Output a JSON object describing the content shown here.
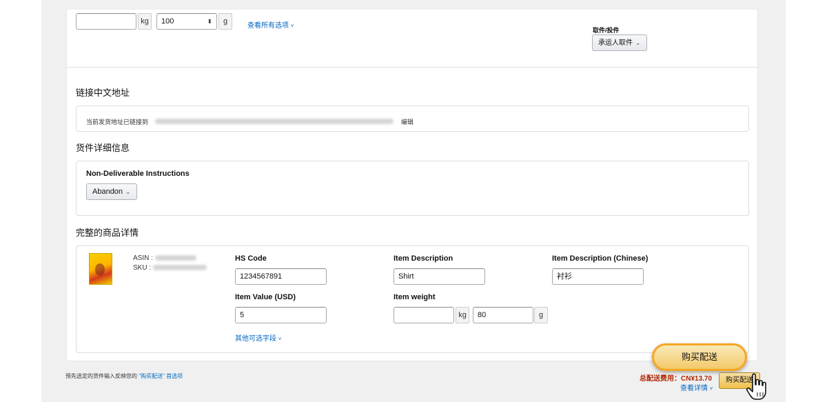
{
  "top": {
    "weight_kg_value": "",
    "weight_kg_unit": "kg",
    "weight_g_value": "100",
    "weight_g_unit": "g",
    "view_all_options_link": "查看所有选项",
    "pickup_label": "取件/投件",
    "pickup_select": "承运人取件"
  },
  "linked_address": {
    "heading": "链接中文地址",
    "text": "当前发货地址已链接到",
    "edit_link": "编辑"
  },
  "shipment_details": {
    "heading": "货件详细信息",
    "non_deliverable_label": "Non-Deliverable Instructions",
    "non_deliverable_value": "Abandon"
  },
  "product_details": {
    "heading": "完整的商品详情",
    "asin_label": "ASIN :",
    "sku_label": "SKU :",
    "hs_code_label": "HS Code",
    "hs_code_value": "1234567891",
    "item_description_label": "Item Description",
    "item_description_value": "Shirt",
    "item_description_cn_label": "Item Description (Chinese)",
    "item_description_cn_value": "衬衫",
    "item_value_label": "Item Value (USD)",
    "item_value_value": "5",
    "item_weight_label": "Item weight",
    "item_weight_kg_value": "",
    "item_weight_kg_unit": "kg",
    "item_weight_g_value": "80",
    "item_weight_g_unit": "g",
    "other_fields_link": "其他可选字段"
  },
  "footer": {
    "note_prefix": "预先选定的货件输入反映您的",
    "note_link": "\"购买配送\" 首选项",
    "total_label": "总配送费用：CN¥13.70",
    "view_details_link": "查看详情",
    "buy_shipping_button": "购买配送",
    "highlight_button": "购买配送"
  },
  "colors": {
    "link": "#0066c0",
    "total": "#b12704",
    "highlight_ring": "#f5a623",
    "button_yellow": "#f0c14b"
  }
}
